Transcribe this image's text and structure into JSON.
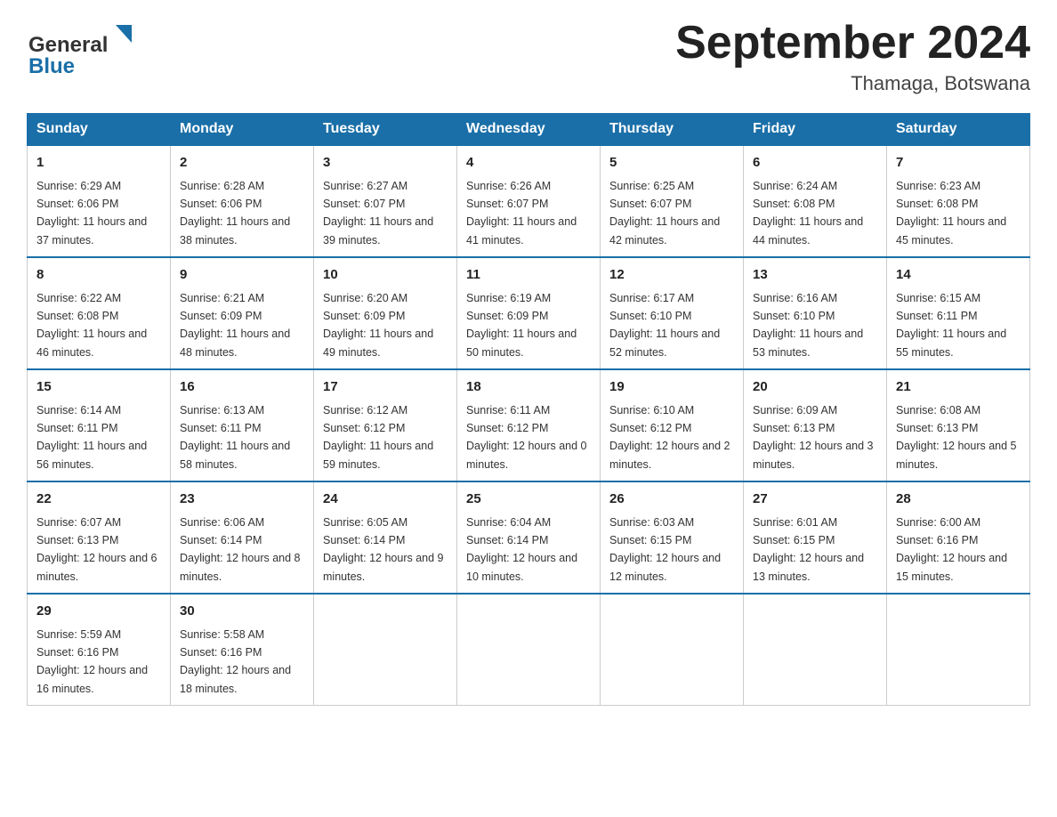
{
  "header": {
    "logo_general": "General",
    "logo_blue": "Blue",
    "month_title": "September 2024",
    "location": "Thamaga, Botswana"
  },
  "days_of_week": [
    "Sunday",
    "Monday",
    "Tuesday",
    "Wednesday",
    "Thursday",
    "Friday",
    "Saturday"
  ],
  "weeks": [
    [
      {
        "day": "1",
        "sunrise": "6:29 AM",
        "sunset": "6:06 PM",
        "daylight": "11 hours and 37 minutes."
      },
      {
        "day": "2",
        "sunrise": "6:28 AM",
        "sunset": "6:06 PM",
        "daylight": "11 hours and 38 minutes."
      },
      {
        "day": "3",
        "sunrise": "6:27 AM",
        "sunset": "6:07 PM",
        "daylight": "11 hours and 39 minutes."
      },
      {
        "day": "4",
        "sunrise": "6:26 AM",
        "sunset": "6:07 PM",
        "daylight": "11 hours and 41 minutes."
      },
      {
        "day": "5",
        "sunrise": "6:25 AM",
        "sunset": "6:07 PM",
        "daylight": "11 hours and 42 minutes."
      },
      {
        "day": "6",
        "sunrise": "6:24 AM",
        "sunset": "6:08 PM",
        "daylight": "11 hours and 44 minutes."
      },
      {
        "day": "7",
        "sunrise": "6:23 AM",
        "sunset": "6:08 PM",
        "daylight": "11 hours and 45 minutes."
      }
    ],
    [
      {
        "day": "8",
        "sunrise": "6:22 AM",
        "sunset": "6:08 PM",
        "daylight": "11 hours and 46 minutes."
      },
      {
        "day": "9",
        "sunrise": "6:21 AM",
        "sunset": "6:09 PM",
        "daylight": "11 hours and 48 minutes."
      },
      {
        "day": "10",
        "sunrise": "6:20 AM",
        "sunset": "6:09 PM",
        "daylight": "11 hours and 49 minutes."
      },
      {
        "day": "11",
        "sunrise": "6:19 AM",
        "sunset": "6:09 PM",
        "daylight": "11 hours and 50 minutes."
      },
      {
        "day": "12",
        "sunrise": "6:17 AM",
        "sunset": "6:10 PM",
        "daylight": "11 hours and 52 minutes."
      },
      {
        "day": "13",
        "sunrise": "6:16 AM",
        "sunset": "6:10 PM",
        "daylight": "11 hours and 53 minutes."
      },
      {
        "day": "14",
        "sunrise": "6:15 AM",
        "sunset": "6:11 PM",
        "daylight": "11 hours and 55 minutes."
      }
    ],
    [
      {
        "day": "15",
        "sunrise": "6:14 AM",
        "sunset": "6:11 PM",
        "daylight": "11 hours and 56 minutes."
      },
      {
        "day": "16",
        "sunrise": "6:13 AM",
        "sunset": "6:11 PM",
        "daylight": "11 hours and 58 minutes."
      },
      {
        "day": "17",
        "sunrise": "6:12 AM",
        "sunset": "6:12 PM",
        "daylight": "11 hours and 59 minutes."
      },
      {
        "day": "18",
        "sunrise": "6:11 AM",
        "sunset": "6:12 PM",
        "daylight": "12 hours and 0 minutes."
      },
      {
        "day": "19",
        "sunrise": "6:10 AM",
        "sunset": "6:12 PM",
        "daylight": "12 hours and 2 minutes."
      },
      {
        "day": "20",
        "sunrise": "6:09 AM",
        "sunset": "6:13 PM",
        "daylight": "12 hours and 3 minutes."
      },
      {
        "day": "21",
        "sunrise": "6:08 AM",
        "sunset": "6:13 PM",
        "daylight": "12 hours and 5 minutes."
      }
    ],
    [
      {
        "day": "22",
        "sunrise": "6:07 AM",
        "sunset": "6:13 PM",
        "daylight": "12 hours and 6 minutes."
      },
      {
        "day": "23",
        "sunrise": "6:06 AM",
        "sunset": "6:14 PM",
        "daylight": "12 hours and 8 minutes."
      },
      {
        "day": "24",
        "sunrise": "6:05 AM",
        "sunset": "6:14 PM",
        "daylight": "12 hours and 9 minutes."
      },
      {
        "day": "25",
        "sunrise": "6:04 AM",
        "sunset": "6:14 PM",
        "daylight": "12 hours and 10 minutes."
      },
      {
        "day": "26",
        "sunrise": "6:03 AM",
        "sunset": "6:15 PM",
        "daylight": "12 hours and 12 minutes."
      },
      {
        "day": "27",
        "sunrise": "6:01 AM",
        "sunset": "6:15 PM",
        "daylight": "12 hours and 13 minutes."
      },
      {
        "day": "28",
        "sunrise": "6:00 AM",
        "sunset": "6:16 PM",
        "daylight": "12 hours and 15 minutes."
      }
    ],
    [
      {
        "day": "29",
        "sunrise": "5:59 AM",
        "sunset": "6:16 PM",
        "daylight": "12 hours and 16 minutes."
      },
      {
        "day": "30",
        "sunrise": "5:58 AM",
        "sunset": "6:16 PM",
        "daylight": "12 hours and 18 minutes."
      },
      null,
      null,
      null,
      null,
      null
    ]
  ],
  "labels": {
    "sunrise": "Sunrise:",
    "sunset": "Sunset:",
    "daylight": "Daylight:"
  }
}
